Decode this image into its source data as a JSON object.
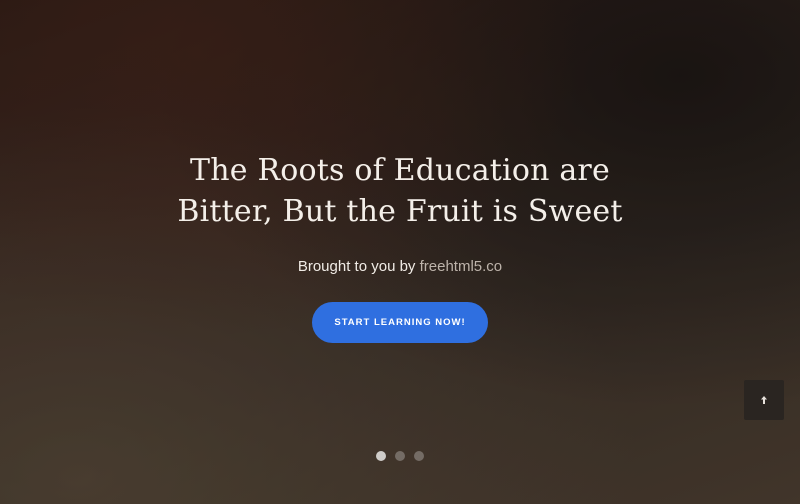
{
  "hero": {
    "headline_line1": "The Roots of Education are",
    "headline_line2": "Bitter, But the Fruit is Sweet",
    "byline_prefix": "Brought to you by",
    "byline_link": "freehtml5.co",
    "cta_label": "START LEARNING NOW!"
  },
  "back_to_top": {
    "icon": "arrow-up-icon"
  },
  "slider": {
    "total_slides": 3,
    "active_index": 0
  },
  "colors": {
    "cta_background": "#2f6fe0",
    "headline_text": "#f4efe9",
    "link_text": "#bdb3aa"
  }
}
